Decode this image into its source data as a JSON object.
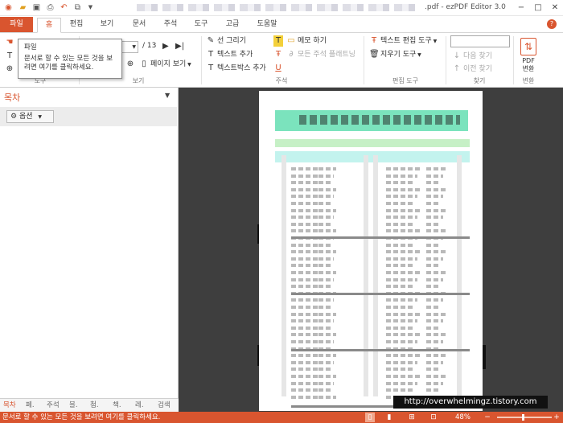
{
  "window": {
    "title_suffix": ".pdf - ezPDF Editor 3.0",
    "controls": [
      "−",
      "□",
      "✕"
    ]
  },
  "menu": {
    "file": "파일",
    "tabs": [
      "홈",
      "편집",
      "보기",
      "문서",
      "주석",
      "도구",
      "고급",
      "도움말"
    ],
    "active_tab": "홈",
    "help_mark": "?"
  },
  "ribbon": {
    "page_total": "/ 13",
    "page_view": "페이지 보기",
    "group_view_label": "보기",
    "group_left_label": "도구",
    "annot": {
      "draw_line": "선 그리기",
      "add_text": "텍스트 추가",
      "add_textbox": "텍스트박스 추가",
      "memo": "메모 하기",
      "all_annot": "모든 주석 플래트닝",
      "underline_icon": "U",
      "label": "주석"
    },
    "edit": {
      "text_edit_tool": "텍스트 편집 도구",
      "eraser_tool": "지우기 도구",
      "label": "편집 도구"
    },
    "find": {
      "next": "다음 찾기",
      "prev": "이전 찾기",
      "label": "찾기"
    },
    "convert": {
      "line1": "PDF",
      "line2": "변환",
      "label": "변환"
    }
  },
  "tooltip": {
    "title": "파일",
    "body": "문서로 할 수 있는 모든 것을 보려면 여기를 클릭하세요."
  },
  "left_panel": {
    "title": "목차",
    "options": "옵션",
    "tabs": [
      "목차",
      "페.",
      "주석",
      "블.",
      "첨.",
      "책.",
      "레.",
      "검색"
    ]
  },
  "watermark": "http://overwhelmingz.tistory.com",
  "status": {
    "text": "문서로 할 수 있는 모든 것을 보려면 여기를 클릭하세요.",
    "zoom": "48%"
  },
  "colors": {
    "accent": "#d9552f",
    "page_header": "#7be3bd",
    "doc_background": "#3e3e3e"
  }
}
